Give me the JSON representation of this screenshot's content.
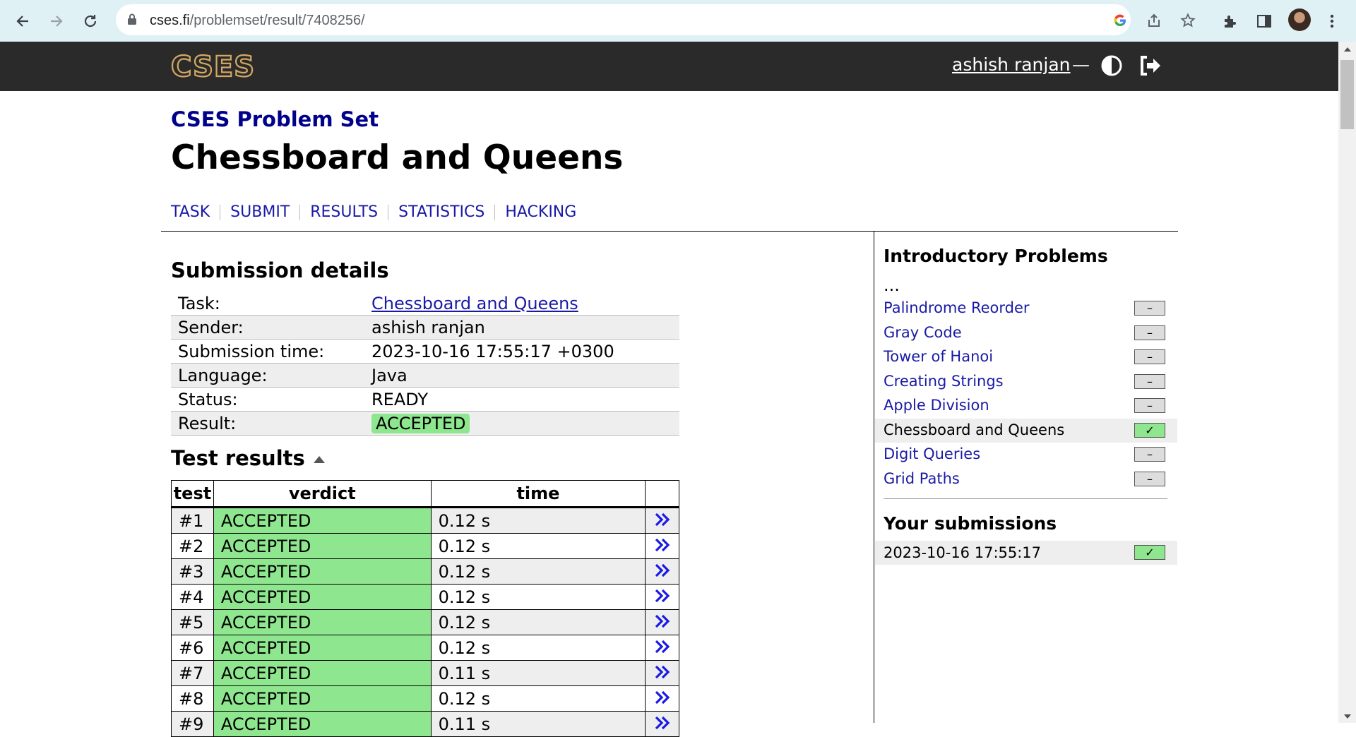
{
  "browser": {
    "url_host": "cses.fi",
    "url_path": "/problemset/result/7408256/"
  },
  "header": {
    "logo_text": "CSES",
    "username": "ashish ranjan",
    "dash": "—"
  },
  "page": {
    "subtitle": "CSES Problem Set",
    "title": "Chessboard and Queens",
    "tabs": [
      "TASK",
      "SUBMIT",
      "RESULTS",
      "STATISTICS",
      "HACKING"
    ]
  },
  "submission": {
    "heading": "Submission details",
    "rows": [
      {
        "key": "Task:",
        "value": "Chessboard and Queens"
      },
      {
        "key": "Sender:",
        "value": "ashish ranjan"
      },
      {
        "key": "Submission time:",
        "value": "2023-10-16 17:55:17 +0300"
      },
      {
        "key": "Language:",
        "value": "Java"
      },
      {
        "key": "Status:",
        "value": "READY"
      },
      {
        "key": "Result:",
        "value": "ACCEPTED"
      }
    ]
  },
  "tests": {
    "heading": "Test results",
    "columns": [
      "test",
      "verdict",
      "time"
    ],
    "rows": [
      {
        "test": "#1",
        "verdict": "ACCEPTED",
        "time": "0.12 s"
      },
      {
        "test": "#2",
        "verdict": "ACCEPTED",
        "time": "0.12 s"
      },
      {
        "test": "#3",
        "verdict": "ACCEPTED",
        "time": "0.12 s"
      },
      {
        "test": "#4",
        "verdict": "ACCEPTED",
        "time": "0.12 s"
      },
      {
        "test": "#5",
        "verdict": "ACCEPTED",
        "time": "0.12 s"
      },
      {
        "test": "#6",
        "verdict": "ACCEPTED",
        "time": "0.12 s"
      },
      {
        "test": "#7",
        "verdict": "ACCEPTED",
        "time": "0.11 s"
      },
      {
        "test": "#8",
        "verdict": "ACCEPTED",
        "time": "0.12 s"
      },
      {
        "test": "#9",
        "verdict": "ACCEPTED",
        "time": "0.11 s"
      }
    ],
    "link_glyph": "»"
  },
  "sidebar": {
    "heading": "Introductory Problems",
    "ellipsis": "...",
    "items": [
      {
        "name": "Palindrome Reorder",
        "status": "–"
      },
      {
        "name": "Gray Code",
        "status": "–"
      },
      {
        "name": "Tower of Hanoi",
        "status": "–"
      },
      {
        "name": "Creating Strings",
        "status": "–"
      },
      {
        "name": "Apple Division",
        "status": "–"
      },
      {
        "name": "Chessboard and Queens",
        "status": "✓"
      },
      {
        "name": "Digit Queries",
        "status": "–"
      },
      {
        "name": "Grid Paths",
        "status": "–"
      }
    ],
    "submissions_heading": "Your submissions",
    "submissions": [
      {
        "time": "2023-10-16 17:55:17",
        "status": "✓"
      }
    ]
  },
  "colors": {
    "accepted": "#8ee68e",
    "header_bg": "#2a2a2a",
    "link": "#1a1aa6",
    "subtitle": "#00008b"
  }
}
